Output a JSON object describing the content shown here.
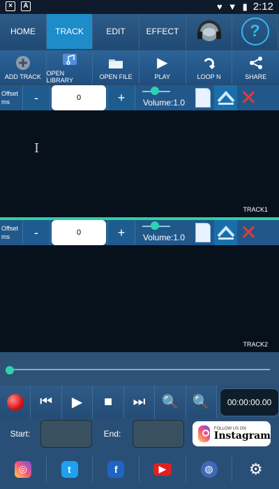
{
  "status": {
    "time": "2:12",
    "left_icons": [
      "notification-x-icon",
      "notification-a-icon"
    ],
    "right_icons": [
      "heart-icon",
      "wifi-icon",
      "battery-icon"
    ]
  },
  "tabs": [
    "HOME",
    "TRACK",
    "EDIT",
    "EFFECT"
  ],
  "actions": [
    "ADD TRACK",
    "OPEN LIBRARY",
    "OPEN FILE",
    "PLAY",
    "LOOP N",
    "SHARE"
  ],
  "tracks": [
    {
      "offset_label": "Offset ms",
      "offset_value": "0",
      "volume": "Volume:1.0",
      "name": "TRACK1"
    },
    {
      "offset_label": "Offset ms",
      "offset_value": "0",
      "volume": "Volume:1.0",
      "name": "TRACK2"
    }
  ],
  "transport": {
    "time": "00:00:00.00"
  },
  "startend": {
    "start_label": "Start:",
    "end_label": "End:",
    "follow_small": "FOLLOW US ON",
    "follow_big": "Instagram"
  },
  "colors": {
    "accent": "#2bd1a5",
    "tab_active": "#1d8cc9",
    "close_red": "#e53a3a"
  }
}
